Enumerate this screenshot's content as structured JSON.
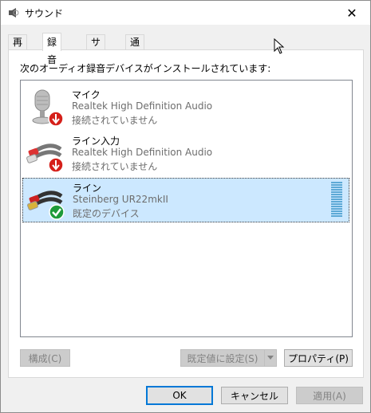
{
  "window": {
    "title": "サウンド",
    "close_label": "✕"
  },
  "tabs": [
    {
      "label": "再生",
      "active": false
    },
    {
      "label": "録音",
      "active": true
    },
    {
      "label": "サウンド",
      "active": false
    },
    {
      "label": "通信",
      "active": false
    }
  ],
  "panel": {
    "description": "次のオーディオ録音デバイスがインストールされています:"
  },
  "devices": [
    {
      "name": "マイク",
      "description": "Realtek High Definition Audio",
      "status": "接続されていません",
      "icon": "microphone-icon",
      "badge": "red-down-arrow",
      "selected": false
    },
    {
      "name": "ライン入力",
      "description": "Realtek High Definition Audio",
      "status": "接続されていません",
      "icon": "rca-cable-icon",
      "badge": "red-down-arrow",
      "selected": false
    },
    {
      "name": "ライン",
      "description": "Steinberg UR22mkII",
      "status": "既定のデバイス",
      "icon": "rca-cable-icon",
      "badge": "green-check",
      "selected": true
    }
  ],
  "panel_buttons": {
    "configure": "構成(C)",
    "set_default": "既定値に設定(S)",
    "properties": "プロパティ(P)"
  },
  "dialog_buttons": {
    "ok": "OK",
    "cancel": "キャンセル",
    "apply": "適用(A)"
  },
  "colors": {
    "selection": "#cce8ff",
    "default_border": "#0078d7",
    "badge_red": "#d5201a",
    "badge_green": "#1e9b3a"
  }
}
